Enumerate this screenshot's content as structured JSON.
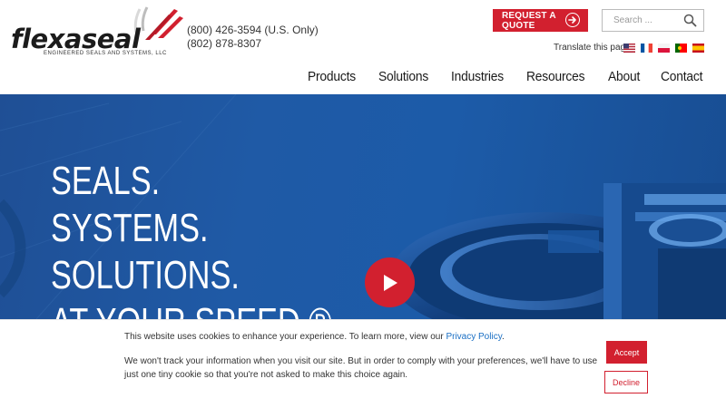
{
  "brand": {
    "name": "flexaseal",
    "tagline": "ENGINEERED SEALS AND SYSTEMS, LLC",
    "accent_color": "#d2202f",
    "hero_color": "#1f5aa6"
  },
  "contact": {
    "phone_us": "(800) 426-3594 (U.S. Only)",
    "phone_intl": "(802) 878-8307"
  },
  "header": {
    "quote_label": "REQUEST A QUOTE",
    "quote_icon": "arrow-right-circle-icon",
    "search": {
      "placeholder": "Search ...",
      "value": "",
      "icon": "search-icon"
    },
    "translate_label": "Translate this page:",
    "flags": [
      "us-flag-icon",
      "fr-flag-icon",
      "pl-flag-icon",
      "pt-flag-icon",
      "es-flag-icon"
    ]
  },
  "nav": {
    "items": [
      {
        "label": "Products"
      },
      {
        "label": "Solutions"
      },
      {
        "label": "Industries"
      },
      {
        "label": "Resources"
      },
      {
        "label": "About"
      },
      {
        "label": "Contact"
      }
    ]
  },
  "hero": {
    "lines": [
      "SEALS.",
      "SYSTEMS.",
      "SOLUTIONS.",
      "AT YOUR SPEED ®"
    ],
    "play_icon": "play-icon"
  },
  "cookie": {
    "line1_prefix": "This website uses cookies to enhance your experience. To learn more, view our",
    "privacy_link": "Privacy Policy",
    "line1_suffix": ".",
    "line2": "We won't track your information when you visit our site. But in order to comply with your preferences, we'll have to use just one tiny cookie so that you're not asked to make this choice again.",
    "accept_label": "Accept",
    "decline_label": "Decline"
  }
}
